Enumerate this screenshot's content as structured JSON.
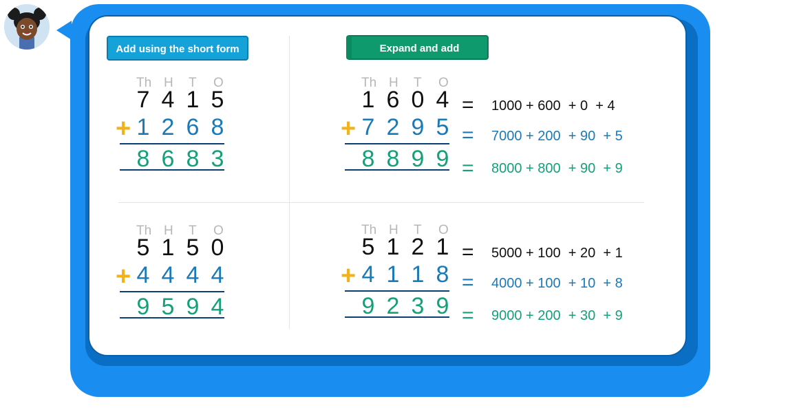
{
  "buttons": {
    "short_form": "Add using the short form",
    "expand": "Expand and add"
  },
  "headers": [
    "Th",
    "H",
    "T",
    "O"
  ],
  "problems": [
    {
      "top": [
        "7",
        "4",
        "1",
        "5"
      ],
      "add": [
        "1",
        "2",
        "6",
        "8"
      ],
      "result": [
        "8",
        "6",
        "8",
        "3"
      ]
    },
    {
      "top": [
        "1",
        "6",
        "0",
        "4"
      ],
      "add": [
        "7",
        "2",
        "9",
        "5"
      ],
      "result": [
        "8",
        "8",
        "9",
        "9"
      ],
      "expanded": {
        "top": "1000 + 600  + 0  + 4",
        "add": "7000 + 200  + 90  + 5",
        "result": "8000 + 800  + 90  + 9"
      }
    },
    {
      "top": [
        "5",
        "1",
        "5",
        "0"
      ],
      "add": [
        "4",
        "4",
        "4",
        "4"
      ],
      "result": [
        "9",
        "5",
        "9",
        "4"
      ]
    },
    {
      "top": [
        "5",
        "1",
        "2",
        "1"
      ],
      "add": [
        "4",
        "1",
        "1",
        "8"
      ],
      "result": [
        "9",
        "2",
        "3",
        "9"
      ],
      "expanded": {
        "top": "5000 + 100  + 20  + 1",
        "add": "4000 + 100  + 10  + 8",
        "result": "9000 + 200  + 30  + 9"
      }
    }
  ],
  "symbols": {
    "plus": "+",
    "equals": "="
  },
  "colors": {
    "frame": "#1a8ef0",
    "short_button": "#14a2d8",
    "expand_button": "#0f9a6e",
    "plus": "#f2b21a",
    "addend": "#1a7ab8",
    "result": "#15a07a",
    "header": "#b7b7b7"
  },
  "icons": {
    "avatar": "girl-avatar-icon"
  }
}
